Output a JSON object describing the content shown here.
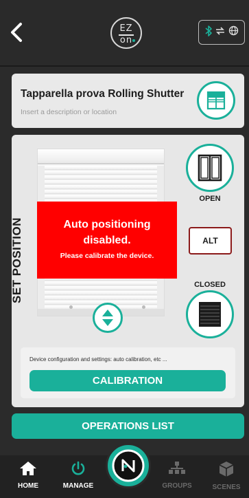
{
  "header": {
    "logo_top": "EZ",
    "logo_bottom": "on",
    "status_icons": [
      "bluetooth-icon",
      "sync-arrows-icon",
      "globe-icon"
    ]
  },
  "device": {
    "title": "Tapparella prova Rolling Shutter",
    "description_placeholder": "Insert a description or location",
    "icon": "window-icon"
  },
  "position_panel": {
    "set_position_label": "SET POSITION",
    "alert_title_line1": "Auto positioning",
    "alert_title_line2": "disabled.",
    "alert_subtitle": "Please calibrate the device.",
    "open_label": "OPEN",
    "closed_label": "CLOSED",
    "alt_label": "ALT",
    "calibration_description": "Device configuration and settings: auto calibration, etc ...",
    "calibration_button": "CALIBRATION"
  },
  "operations_button": "OPERATIONS LIST",
  "bottom_nav": {
    "home": "HOME",
    "manage": "MANAGE",
    "groups": "GROUPS",
    "scenes": "SCENES"
  },
  "colors": {
    "accent": "#1ab09a",
    "alert": "#ff0000",
    "alt_border": "#8b1a1a",
    "background": "#2b2b2b"
  }
}
